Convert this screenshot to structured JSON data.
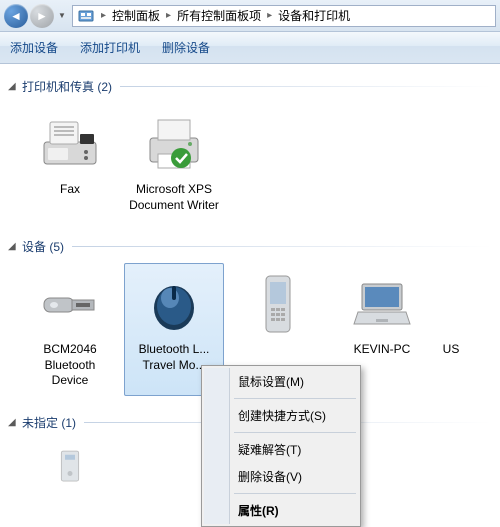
{
  "breadcrumb": {
    "items": [
      "控制面板",
      "所有控制面板项",
      "设备和打印机"
    ]
  },
  "toolbar": {
    "add_device": "添加设备",
    "add_printer": "添加打印机",
    "remove_device": "删除设备"
  },
  "sections": {
    "printers": {
      "title": "打印机和传真 (2)",
      "items": [
        {
          "label": "Fax"
        },
        {
          "label": "Microsoft XPS Document Writer"
        }
      ]
    },
    "devices": {
      "title": "设备 (5)",
      "items": [
        {
          "label": "BCM2046 Bluetooth Device"
        },
        {
          "label": "Bluetooth L... Travel Mo..."
        },
        {
          "label": ""
        },
        {
          "label": "KEVIN-PC"
        },
        {
          "label": "US"
        }
      ]
    },
    "unspecified": {
      "title": "未指定 (1)"
    }
  },
  "context_menu": {
    "mouse_settings": "鼠标设置(M)",
    "create_shortcut": "创建快捷方式(S)",
    "troubleshoot": "疑难解答(T)",
    "remove": "删除设备(V)",
    "properties": "属性(R)"
  }
}
